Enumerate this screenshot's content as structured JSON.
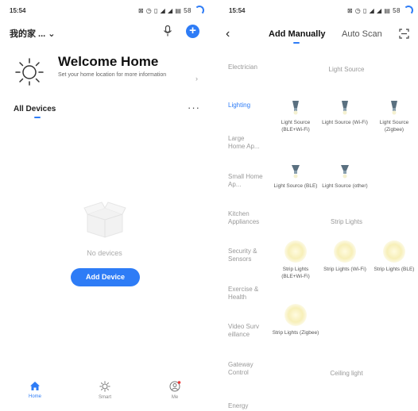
{
  "left": {
    "status": {
      "time": "15:54",
      "icons": "⊠ ◷ ▯ ◢ ◢ ▤ 58"
    },
    "header": {
      "home_name": "我的家 ...",
      "dropdown_glyph": "⌄"
    },
    "welcome": {
      "title": "Welcome Home",
      "subtitle": "Set your home location for more information",
      "chevron": "›"
    },
    "devices": {
      "label": "All Devices",
      "more": "···"
    },
    "empty": {
      "message": "No devices",
      "button": "Add Device"
    },
    "nav": [
      {
        "label": "Home",
        "icon": "home-icon"
      },
      {
        "label": "Smart",
        "icon": "sun-icon"
      },
      {
        "label": "Me",
        "icon": "profile-icon"
      }
    ],
    "accent": "#2e7cf6"
  },
  "right": {
    "status": {
      "time": "15:54",
      "icons": "⊠ ◷ ▯ ◢ ◢ ▤ 58"
    },
    "tabs": {
      "manual": "Add Manually",
      "scan": "Auto Scan",
      "back": "‹"
    },
    "categories": [
      "Electrician",
      "Lighting",
      "Large Home Ap...",
      "Small Home Ap...",
      "Kitchen Appliances",
      "Security & Sensors",
      "Exercise & Health",
      "Video Surv eillance",
      "Gateway Control",
      "Energy"
    ],
    "sections": {
      "light_source": "Light Source",
      "strip_lights": "Strip Lights",
      "ceiling_light": "Ceiling light"
    },
    "light_devices": [
      "Light Source (BLE+Wi-Fi)",
      "Light Source (Wi-Fi)",
      "Light Source (Zigbee)",
      "Light Source (BLE)",
      "Light Source (other)"
    ],
    "strip_devices": [
      "Strip Lights (BLE+Wi-Fi)",
      "Strip Lights (Wi-Fi)",
      "Strip Lights (BLE)",
      "Strip Lights (Zigbee)"
    ]
  }
}
